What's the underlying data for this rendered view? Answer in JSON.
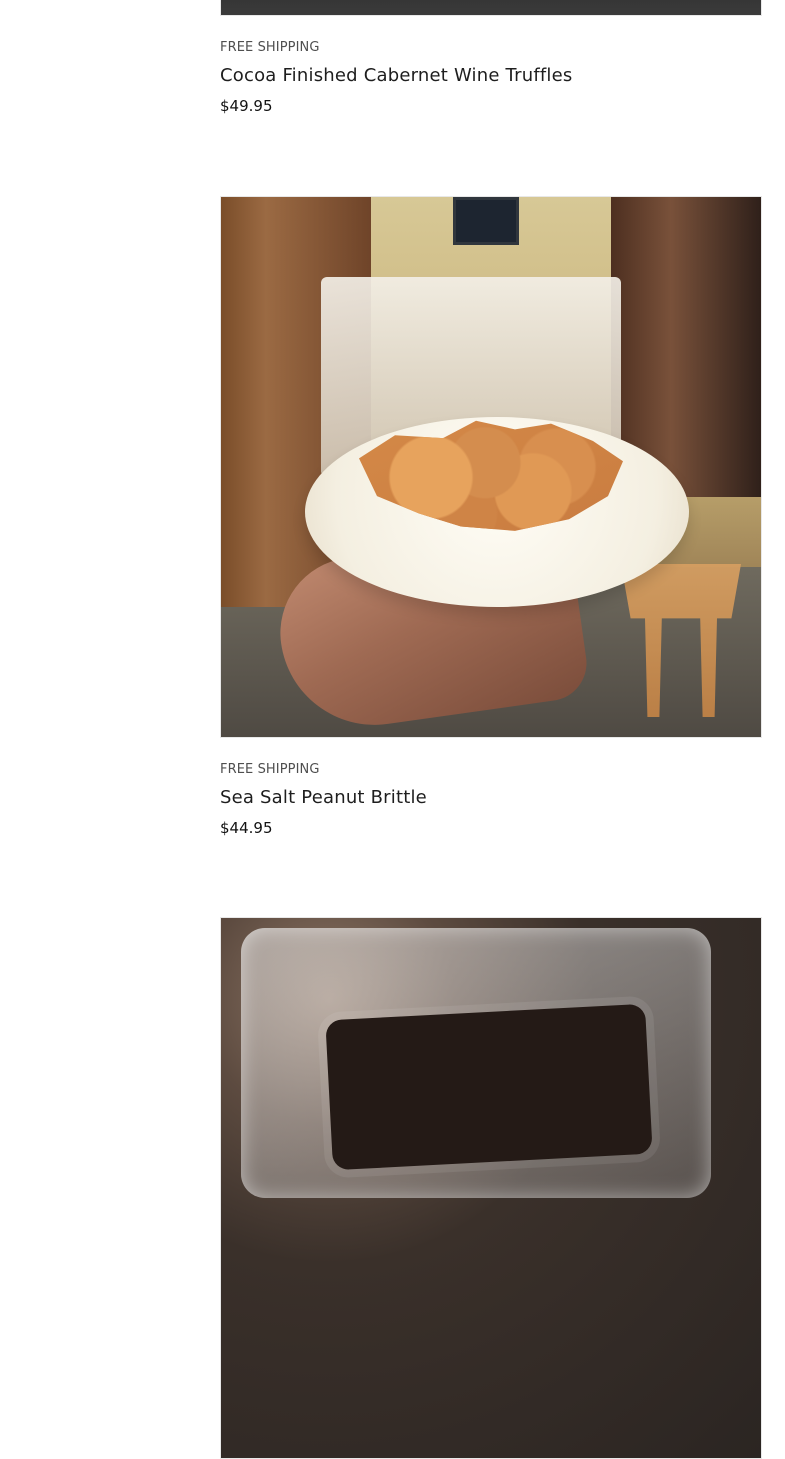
{
  "products": [
    {
      "badge": "FREE SHIPPING",
      "title": "Cocoa Finished Cabernet Wine Truffles",
      "price": "$49.95",
      "image_icon": "truffles-photo"
    },
    {
      "badge": "FREE SHIPPING",
      "title": "Sea Salt Peanut Brittle",
      "price": "$44.95",
      "image_icon": "peanut-brittle-photo"
    },
    {
      "badge": "",
      "title": "",
      "price": "",
      "image_icon": "chocolate-bag-photo"
    }
  ]
}
